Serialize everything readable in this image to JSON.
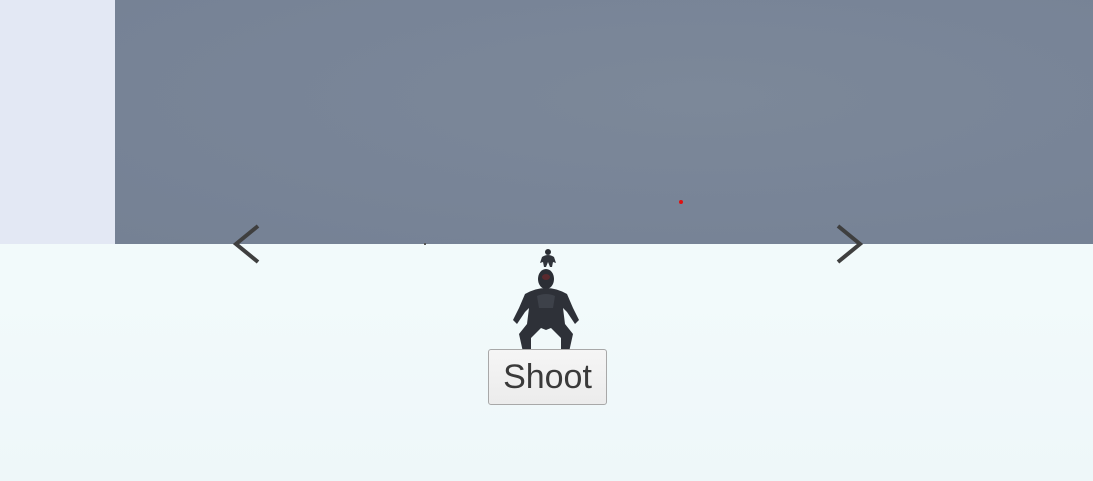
{
  "controls": {
    "shoot_label": "Shoot",
    "left_arrow_icon": "chevron-left-icon",
    "right_arrow_icon": "chevron-right-icon"
  },
  "scene": {
    "sky_color": "#e3e8f4",
    "wall_color": "#788497",
    "ground_color": "#f2fafb",
    "crosshair_color": "#e01010"
  }
}
